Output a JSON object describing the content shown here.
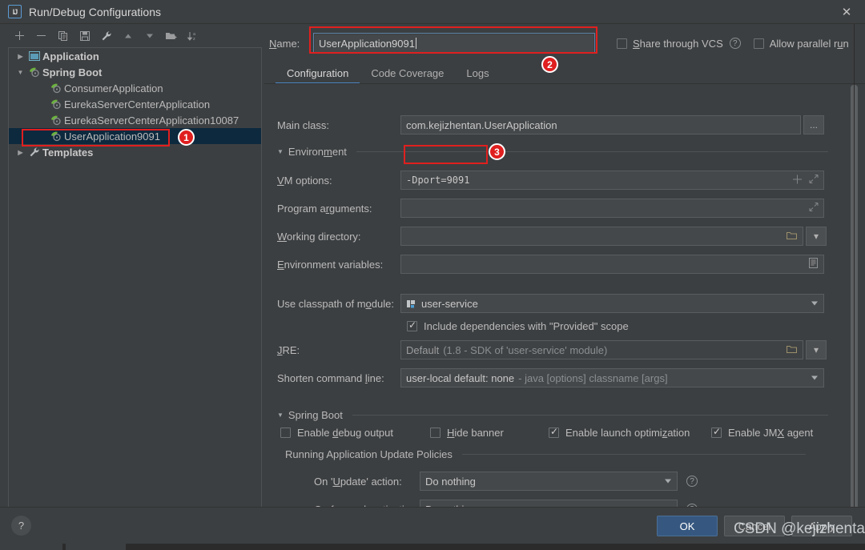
{
  "window": {
    "title": "Run/Debug Configurations",
    "app_icon": "IJ",
    "close_icon": "close-icon"
  },
  "toolbar": {
    "buttons": [
      {
        "name": "add-configuration-button",
        "icon": "plus-icon",
        "tooltip": "Add New Configuration"
      },
      {
        "name": "remove-configuration-button",
        "icon": "minus-icon",
        "tooltip": "Remove Configuration"
      },
      {
        "name": "copy-configuration-button",
        "icon": "copy-icon",
        "tooltip": "Copy Configuration"
      },
      {
        "name": "save-configuration-button",
        "icon": "save-icon",
        "tooltip": "Save Configuration"
      },
      {
        "name": "edit-templates-button",
        "icon": "wrench-icon",
        "tooltip": "Edit Templates"
      },
      {
        "name": "move-up-button",
        "icon": "arrow-up-icon",
        "tooltip": "Move Up"
      },
      {
        "name": "move-down-button",
        "icon": "arrow-down-icon",
        "tooltip": "Move Down"
      },
      {
        "name": "new-folder-button",
        "icon": "folder-add-icon",
        "tooltip": "Create New Folder"
      },
      {
        "name": "sort-configurations-button",
        "icon": "sort-az-icon",
        "tooltip": "Sort Configurations"
      }
    ]
  },
  "tree": {
    "items": [
      {
        "label": "Application",
        "level": 0,
        "expanded": false,
        "twisty": "collapsed",
        "icon": "application-icon",
        "bold": true,
        "selected": false
      },
      {
        "label": "Spring Boot",
        "level": 0,
        "expanded": true,
        "twisty": "expanded",
        "icon": "spring-boot-icon",
        "bold": true,
        "selected": false
      },
      {
        "label": "ConsumerApplication",
        "level": 1,
        "expanded": false,
        "twisty": "none",
        "icon": "spring-boot-icon",
        "bold": false,
        "selected": false
      },
      {
        "label": "EurekaServerCenterApplication",
        "level": 1,
        "expanded": false,
        "twisty": "none",
        "icon": "spring-boot-icon",
        "bold": false,
        "selected": false
      },
      {
        "label": "EurekaServerCenterApplication10087",
        "level": 1,
        "expanded": false,
        "twisty": "none",
        "icon": "spring-boot-icon",
        "bold": false,
        "selected": false
      },
      {
        "label": "UserApplication9091",
        "level": 1,
        "expanded": false,
        "twisty": "none",
        "icon": "spring-boot-icon",
        "bold": false,
        "selected": true
      },
      {
        "label": "Templates",
        "level": 0,
        "expanded": false,
        "twisty": "collapsed",
        "icon": "wrench-icon",
        "bold": true,
        "selected": false
      }
    ]
  },
  "header": {
    "name_label": "Name:",
    "name_value": "UserApplication9091",
    "share_through_vcs": {
      "label": "Share through VCS",
      "checked": false,
      "help_icon": "question-icon"
    },
    "allow_parallel_run": {
      "label": "Allow parallel run",
      "checked": false
    }
  },
  "tabs": [
    {
      "label": "Configuration",
      "active": true
    },
    {
      "label": "Code Coverage",
      "active": false
    },
    {
      "label": "Logs",
      "active": false
    }
  ],
  "form": {
    "main_class": {
      "label": "Main class:",
      "value": "com.kejizhentan.UserApplication",
      "browse_label": "..."
    },
    "environment_section": {
      "title": "Environment",
      "expanded": true
    },
    "vm_options": {
      "label": "VM options:",
      "value": "-Dport=9091",
      "add_icon": "plus-icon",
      "expand_icon": "expand-icon"
    },
    "program_arguments": {
      "label": "Program arguments:",
      "value": "",
      "expand_icon": "expand-icon"
    },
    "working_directory": {
      "label": "Working directory:",
      "value": "",
      "browse_icon": "folder-icon",
      "dropdown_icon": "chevron-down-icon"
    },
    "environment_variables": {
      "label": "Environment variables:",
      "value": "",
      "list_icon": "list-icon"
    },
    "use_classpath_of_module": {
      "label": "Use classpath of module:",
      "value": "user-service",
      "icon": "module-icon"
    },
    "include_provided_scope": {
      "label": "Include dependencies with \"Provided\" scope",
      "checked": true
    },
    "jre": {
      "label": "JRE:",
      "value": "Default",
      "hint": "(1.8 - SDK of 'user-service' module)",
      "browse_icon": "folder-icon",
      "dropdown_icon": "chevron-down-icon"
    },
    "shorten_command_line": {
      "label": "Shorten command line:",
      "value": "user-local default: none",
      "hint": "- java [options] classname [args]"
    }
  },
  "spring_boot": {
    "section_title": "Spring Boot",
    "checkboxes": [
      {
        "label": "Enable debug output",
        "checked": false,
        "name": "enable-debug-output-checkbox"
      },
      {
        "label": "Hide banner",
        "checked": false,
        "name": "hide-banner-checkbox"
      },
      {
        "label": "Enable launch optimization",
        "checked": true,
        "name": "enable-launch-optimization-checkbox"
      },
      {
        "label": "Enable JMX agent",
        "checked": true,
        "name": "enable-jmx-agent-checkbox"
      }
    ],
    "update_policies": {
      "section_title": "Running Application Update Policies",
      "on_update_action": {
        "label": "On 'Update' action:",
        "value": "Do nothing",
        "help_icon": "question-icon"
      },
      "on_frame_deactivation": {
        "label": "On frame deactivation:",
        "value": "Do nothing",
        "help_icon": "question-icon"
      }
    }
  },
  "footer": {
    "help_label": "?",
    "ok_label": "OK",
    "cancel_label": "Cancel",
    "apply_label": "Apply"
  },
  "annotations": {
    "badge_1": "1",
    "badge_2": "2",
    "badge_3": "3",
    "highlight_color": "#e01f1f"
  },
  "watermark": "CSDN @kejizhentan",
  "colors": {
    "background": "#3c3f41",
    "selection": "#0d293e",
    "accent": "#4a88c7",
    "primary_button": "#365880",
    "annotation_red": "#e01f1f"
  }
}
